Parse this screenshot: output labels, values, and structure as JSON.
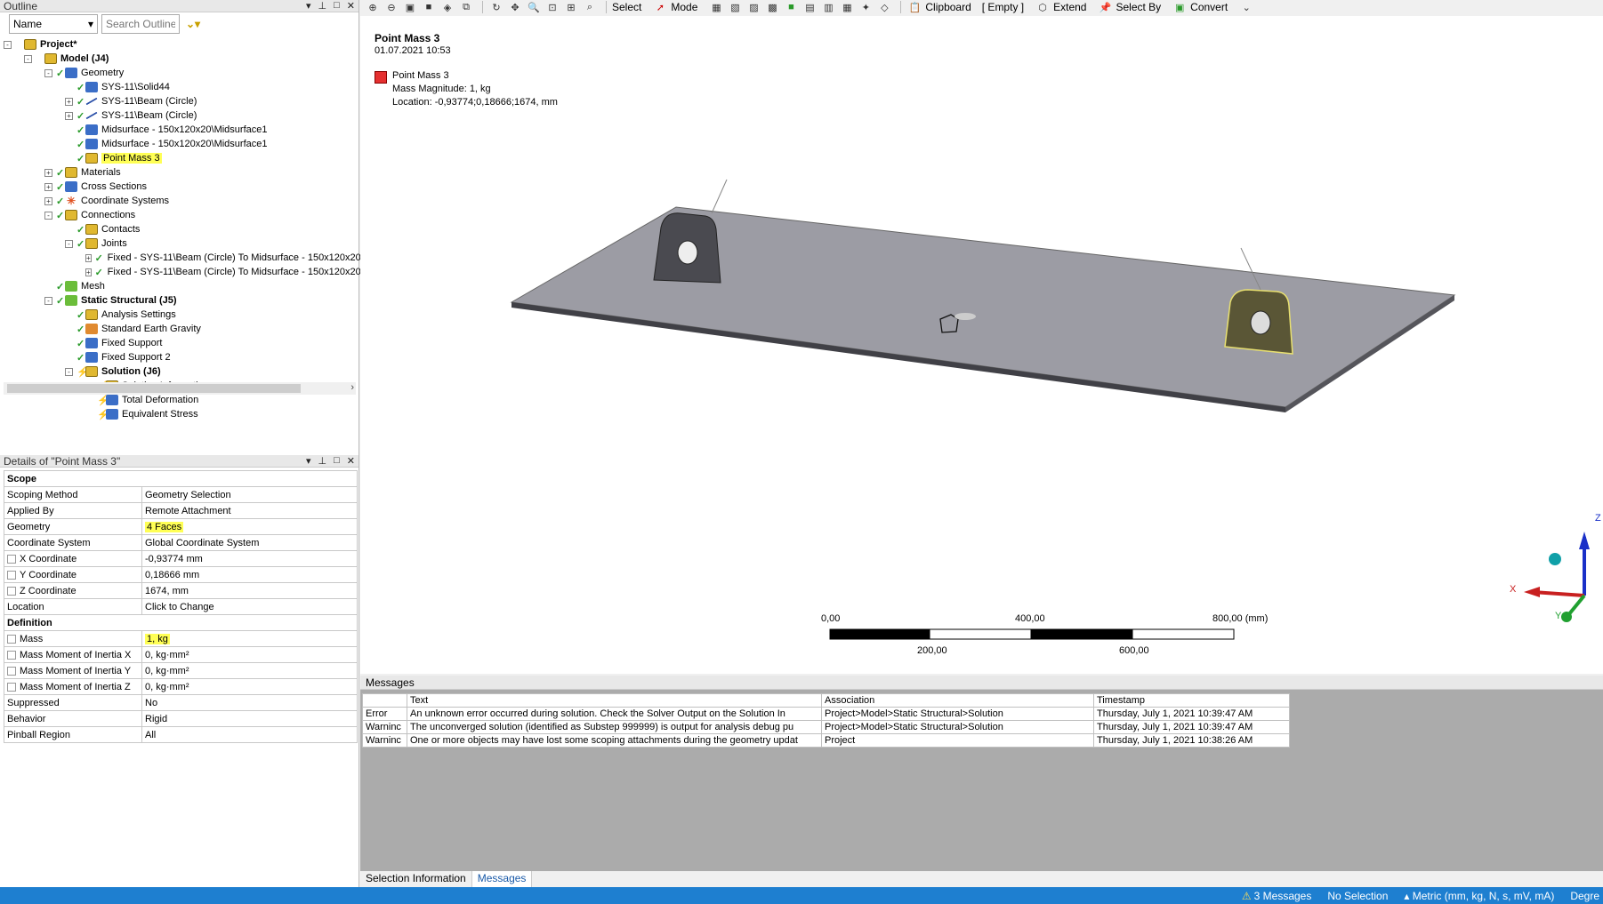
{
  "outline": {
    "title": "Outline",
    "filter_select": "Name",
    "search_placeholder": "Search Outline",
    "tree": [
      {
        "label": "Project*",
        "level": 0,
        "bold": true,
        "expander": "-",
        "check": "",
        "icon": "project-icon"
      },
      {
        "label": "Model (J4)",
        "level": 1,
        "bold": true,
        "expander": "-",
        "check": "",
        "icon": "model-icon"
      },
      {
        "label": "Geometry",
        "level": 2,
        "expander": "-",
        "check": "✓",
        "icon": "geometry-icon"
      },
      {
        "label": "SYS-11\\Solid44",
        "level": 3,
        "expander": "",
        "check": "✓",
        "icon": "solid-icon"
      },
      {
        "label": "SYS-11\\Beam (Circle)",
        "level": 3,
        "expander": "+",
        "check": "✓",
        "icon": "beam-icon"
      },
      {
        "label": "SYS-11\\Beam (Circle)",
        "level": 3,
        "expander": "+",
        "check": "✓",
        "icon": "beam-icon"
      },
      {
        "label": "Midsurface - 150x120x20\\Midsurface1",
        "level": 3,
        "expander": "",
        "check": "✓",
        "icon": "surface-icon"
      },
      {
        "label": "Midsurface - 150x120x20\\Midsurface1",
        "level": 3,
        "expander": "",
        "check": "✓",
        "icon": "surface-icon"
      },
      {
        "label": "Point Mass 3",
        "level": 3,
        "expander": "",
        "check": "✓",
        "icon": "point-mass-icon",
        "highlight": true
      },
      {
        "label": "Materials",
        "level": 2,
        "expander": "+",
        "check": "✓",
        "icon": "materials-icon"
      },
      {
        "label": "Cross Sections",
        "level": 2,
        "expander": "+",
        "check": "✓",
        "icon": "cross-sections-icon"
      },
      {
        "label": "Coordinate Systems",
        "level": 2,
        "expander": "+",
        "check": "✓",
        "icon": "coordinate-systems-icon"
      },
      {
        "label": "Connections",
        "level": 2,
        "expander": "-",
        "check": "✓",
        "icon": "connections-icon"
      },
      {
        "label": "Contacts",
        "level": 3,
        "expander": "",
        "check": "✓",
        "icon": "contacts-icon"
      },
      {
        "label": "Joints",
        "level": 3,
        "expander": "-",
        "check": "✓",
        "icon": "joints-icon"
      },
      {
        "label": "Fixed - SYS-11\\Beam (Circle) To Midsurface - 150x120x20",
        "level": 4,
        "expander": "+",
        "check": "✓",
        "icon": "joint-icon"
      },
      {
        "label": "Fixed - SYS-11\\Beam (Circle) To Midsurface - 150x120x20",
        "level": 4,
        "expander": "+",
        "check": "✓",
        "icon": "joint-icon"
      },
      {
        "label": "Mesh",
        "level": 2,
        "expander": "",
        "check": "✓",
        "icon": "mesh-icon"
      },
      {
        "label": "Static Structural (J5)",
        "level": 2,
        "bold": true,
        "expander": "-",
        "check": "✓",
        "icon": "static-structural-icon"
      },
      {
        "label": "Analysis Settings",
        "level": 3,
        "expander": "",
        "check": "✓",
        "icon": "analysis-settings-icon"
      },
      {
        "label": "Standard Earth Gravity",
        "level": 3,
        "expander": "",
        "check": "✓",
        "icon": "gravity-icon"
      },
      {
        "label": "Fixed Support",
        "level": 3,
        "expander": "",
        "check": "✓",
        "icon": "fixed-support-icon"
      },
      {
        "label": "Fixed Support 2",
        "level": 3,
        "expander": "",
        "check": "✓",
        "icon": "fixed-support-icon"
      },
      {
        "label": "Solution (J6)",
        "level": 3,
        "bold": true,
        "expander": "-",
        "check": "✗",
        "icon": "solution-icon"
      },
      {
        "label": "Solution Information",
        "level": 4,
        "expander": "",
        "check": "✗",
        "icon": "solution-info-icon"
      },
      {
        "label": "Total Deformation",
        "level": 4,
        "expander": "",
        "check": "✗",
        "icon": "deformation-icon"
      },
      {
        "label": "Equivalent Stress",
        "level": 4,
        "expander": "",
        "check": "✗",
        "icon": "stress-icon"
      }
    ]
  },
  "details": {
    "title": "Details of \"Point Mass 3\"",
    "rows": [
      {
        "type": "section",
        "label": "Scope"
      },
      {
        "label": "Scoping Method",
        "value": "Geometry Selection"
      },
      {
        "label": "Applied By",
        "value": "Remote Attachment"
      },
      {
        "label": "Geometry",
        "value": "4 Faces",
        "highlight": true
      },
      {
        "label": "Coordinate System",
        "value": "Global Coordinate System"
      },
      {
        "label": "X Coordinate",
        "value": "-0,93774 mm",
        "checkbox": true
      },
      {
        "label": "Y Coordinate",
        "value": "0,18666 mm",
        "checkbox": true
      },
      {
        "label": "Z Coordinate",
        "value": "1674, mm",
        "checkbox": true
      },
      {
        "label": "Location",
        "value": "Click to Change"
      },
      {
        "type": "section",
        "label": "Definition"
      },
      {
        "label": "Mass",
        "value": "1, kg",
        "checkbox": true,
        "highlight": true
      },
      {
        "label": "Mass Moment of Inertia X",
        "value": "0, kg·mm²",
        "checkbox": true
      },
      {
        "label": "Mass Moment of Inertia Y",
        "value": "0, kg·mm²",
        "checkbox": true
      },
      {
        "label": "Mass Moment of Inertia Z",
        "value": "0, kg·mm²",
        "checkbox": true
      },
      {
        "label": "Suppressed",
        "value": "No"
      },
      {
        "label": "Behavior",
        "value": "Rigid"
      },
      {
        "label": "Pinball Region",
        "value": "All"
      }
    ]
  },
  "toolbar": {
    "select_label": "Select",
    "mode_label": "Mode",
    "clipboard_label": "Clipboard",
    "empty_label": "[ Empty ]",
    "extend_label": "Extend",
    "select_by_label": "Select By",
    "convert_label": "Convert"
  },
  "viewport": {
    "title": "Point Mass 3",
    "date": "01.07.2021 10:53",
    "legend_name": "Point Mass 3",
    "legend_line1": "Mass Magnitude: 1, kg",
    "legend_line2": "Location: -0,93774;0,18666;1674, mm",
    "scale": {
      "label_0": "0,00",
      "label_400": "400,00",
      "label_800": "800,00 (mm)",
      "label_200": "200,00",
      "label_600": "600,00"
    },
    "triad": {
      "x": "X",
      "y": "Y",
      "z": "Z"
    }
  },
  "messages": {
    "title": "Messages",
    "columns": [
      "",
      "Text",
      "Association",
      "Timestamp"
    ],
    "rows": [
      {
        "type": "Error",
        "text": "An unknown error occurred during solution.  Check the Solver Output on the Solution In",
        "association": "Project>Model>Static Structural>Solution",
        "timestamp": "Thursday, July 1, 2021 10:39:47 AM"
      },
      {
        "type": "Warninc",
        "text": "The unconverged solution (identified as Substep 999999) is output for analysis debug pu",
        "association": "Project>Model>Static Structural>Solution",
        "timestamp": "Thursday, July 1, 2021 10:39:47 AM"
      },
      {
        "type": "Warninc",
        "text": "One or more objects may have lost some scoping attachments during the geometry updat",
        "association": "Project",
        "timestamp": "Thursday, July 1, 2021 10:38:26 AM"
      }
    ],
    "tabs": [
      "Selection Information",
      "Messages"
    ]
  },
  "status": {
    "messages": "3 Messages",
    "selection": "No Selection",
    "units": "Metric (mm, kg, N, s, mV, mA)",
    "degrees": "Degre"
  },
  "colors": {
    "status_bar": "#1e7fd0",
    "highlight": "#ffff55",
    "point_mass": "#e53030"
  }
}
